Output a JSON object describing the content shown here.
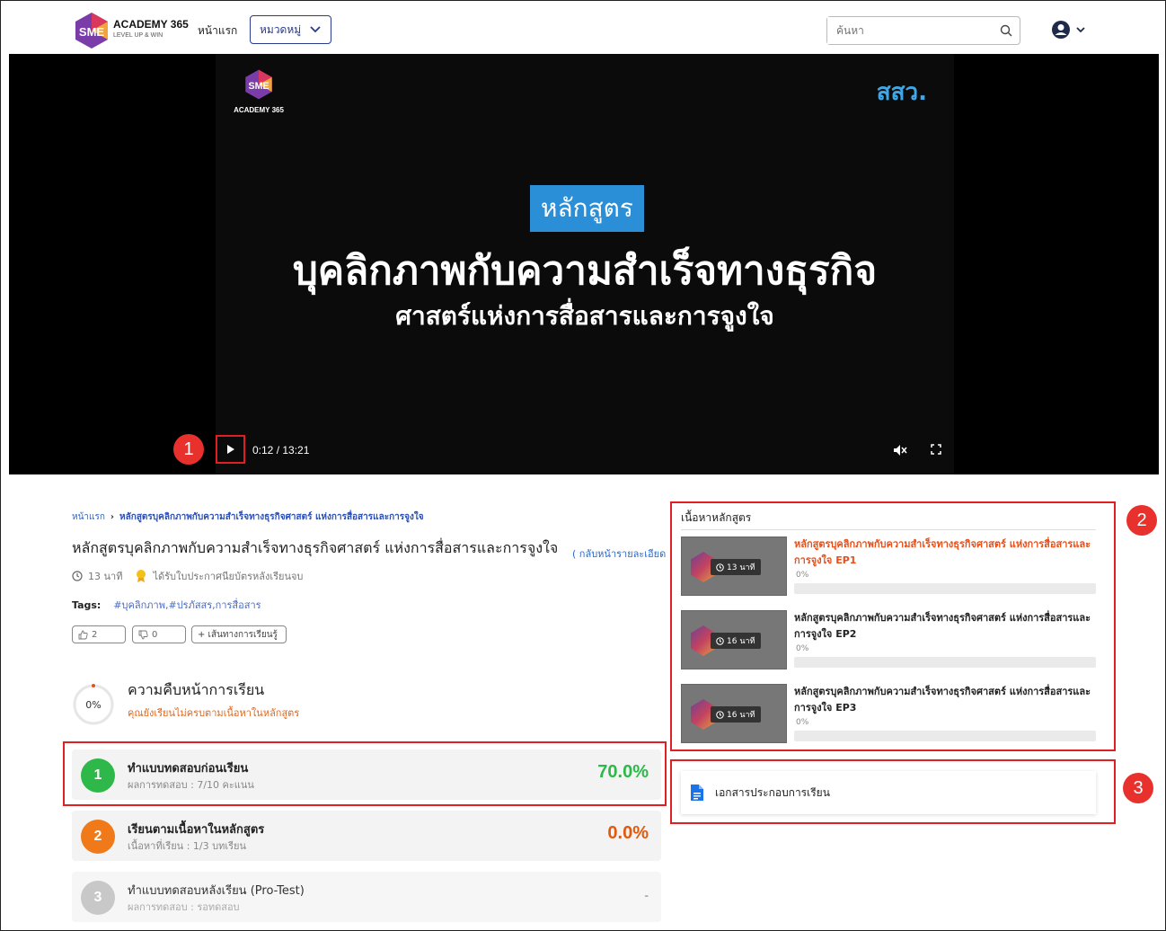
{
  "header": {
    "logo_text": "ACADEMY 365",
    "logo_sub": "LEVEL UP & WIN",
    "logo_mark": "SME",
    "nav_home": "หน้าแรก",
    "category_label": "หมวดหมู่",
    "search_placeholder": "ค้นหา"
  },
  "video": {
    "logo_mark": "SME",
    "logo_sub": "ACADEMY 365",
    "brand": "สสว.",
    "badge": "หลักสูตร",
    "title": "บุคลิกภาพกับความสำเร็จทางธุรกิจ",
    "subtitle": "ศาสตร์แห่งการสื่อสารและการจูงใจ",
    "time": "0:12 / 13:21"
  },
  "markers": [
    "1",
    "2",
    "3"
  ],
  "breadcrumb": {
    "home": "หน้าแรก",
    "sep": "›",
    "current": "หลักสูตรบุคลิกภาพกับความสำเร็จทางธุรกิจศาสตร์ แห่งการสื่อสารและการจูงใจ"
  },
  "course": {
    "title": "หลักสูตรบุคลิกภาพกับความสำเร็จทางธุรกิจศาสตร์ แห่งการสื่อสารและการจูงใจ",
    "back": "( กลับหน้ารายละเอียด",
    "duration": "13 นาที",
    "certificate": "ได้รับใบประกาศนียบัตรหลังเรียนจบ",
    "tags_label": "Tags:",
    "tags": "#บุคลิกภาพ,#ปรภัสสร,การสื่อสาร",
    "likes": "2",
    "dislikes": "0",
    "add_path": "+ เส้นทางการเรียนรู้"
  },
  "progress": {
    "percent_label": "0%",
    "title": "ความคืบหน้าการเรียน",
    "note": "คุณยังเรียนไม่ครบตามเนื้อหาในหลักสูตร"
  },
  "steps": [
    {
      "num": "1",
      "title": "ทำแบบทดสอบก่อนเรียน",
      "sub": "ผลการทดสอบ : 7/10 คะแนน",
      "value": "70.0%",
      "color": "#2fb84a",
      "value_color": "#2fb84a"
    },
    {
      "num": "2",
      "title": "เรียนตามเนื้อหาในหลักสูตร",
      "sub": "เนื้อหาที่เรียน : 1/3 บทเรียน",
      "value": "0.0%",
      "color": "#f07a1a",
      "value_color": "#e05a10"
    },
    {
      "num": "3",
      "title": "ทำแบบทดสอบหลังเรียน (Pro-Test)",
      "sub": "ผลการทดสอบ : รอทดสอบ",
      "value": "-",
      "color": "#c8c8c8",
      "value_color": "#aaa"
    }
  ],
  "panel": {
    "title": "เนื้อหาหลักสูตร",
    "episodes": [
      {
        "title": "หลักสูตรบุคลิกภาพกับความสำเร็จทางธุรกิจศาสตร์ แห่งการสื่อสารและการจูงใจ EP1",
        "duration": "13 นาที",
        "percent": "0%",
        "active": true
      },
      {
        "title": "หลักสูตรบุคลิกภาพกับความสำเร็จทางธุรกิจศาสตร์ แห่งการสื่อสารและการจูงใจ EP2",
        "duration": "16 นาที",
        "percent": "0%",
        "active": false
      },
      {
        "title": "หลักสูตรบุคลิกภาพกับความสำเร็จทางธุรกิจศาสตร์ แห่งการสื่อสารและการจูงใจ EP3",
        "duration": "16 นาที",
        "percent": "0%",
        "active": false
      }
    ],
    "document": "เอกสารประกอบการเรียน"
  },
  "colors": {
    "accent": "#2a3a8c",
    "active_episode": "#e8501a",
    "marker": "#e8302c"
  }
}
